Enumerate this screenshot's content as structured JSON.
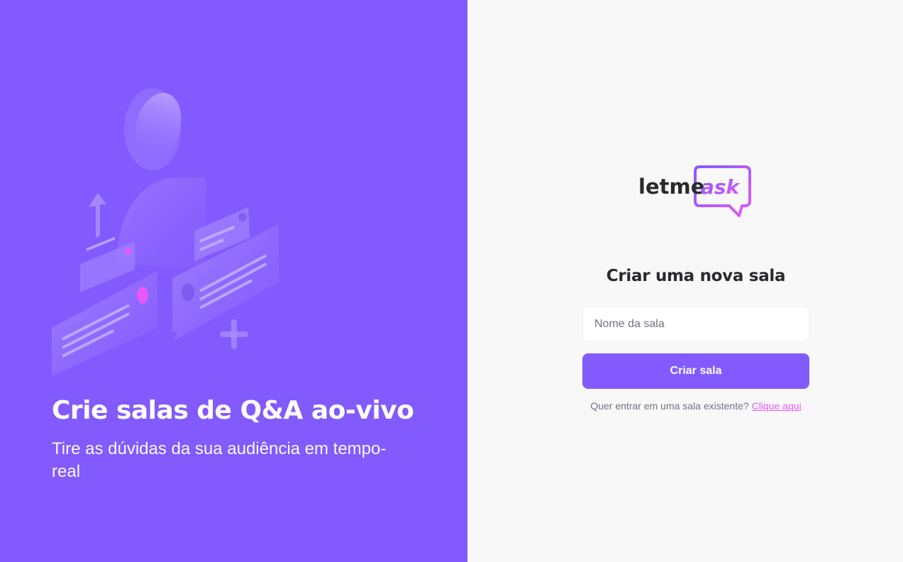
{
  "aside": {
    "title": "Crie salas de Q&A ao-vivo",
    "subtitle": "Tire as dúvidas da sua audiência em tempo-real"
  },
  "logo": {
    "word1": "letme",
    "word2": "ask"
  },
  "form": {
    "title": "Criar uma nova sala",
    "room_name_placeholder": "Nome da sala",
    "room_name_value": "",
    "submit_label": "Criar sala",
    "existing_prompt": "Quer entrar em uma sala existente?",
    "existing_link": "Clique aqui"
  },
  "colors": {
    "brand_purple": "#835afd",
    "accent_pink": "#e559f9",
    "dark_text": "#29292e",
    "muted_text": "#737380",
    "background": "#f8f8f8"
  },
  "icons": {
    "illustration": "person-with-chat-bubbles-illustration",
    "logo": "speech-bubble-logo"
  }
}
